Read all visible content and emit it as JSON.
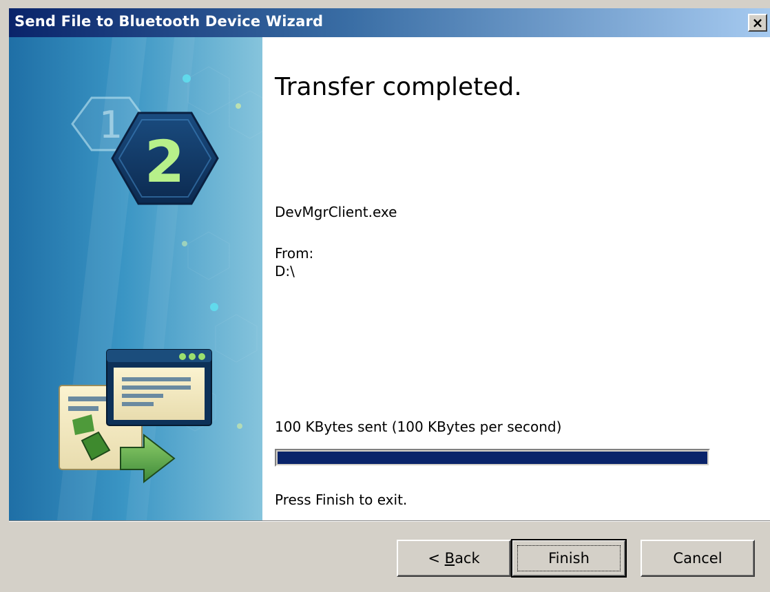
{
  "window": {
    "title": "Send File to Bluetooth Device Wizard",
    "close_label": "×"
  },
  "side_image": {
    "step_inactive": "1",
    "step_active": "2",
    "icon_name": "file-transfer-illustration"
  },
  "content": {
    "heading": "Transfer completed.",
    "file_name": "DevMgrClient.exe",
    "from_label": "From:",
    "from_path": "D:\\",
    "status": "100 KBytes sent (100 KBytes per second)",
    "progress_fraction": 1.0,
    "instruction": "Press Finish to exit."
  },
  "buttons": {
    "back_prefix": "< ",
    "back_accel": "B",
    "back_rest": "ack",
    "finish": "Finish",
    "cancel": "Cancel"
  },
  "colors": {
    "titlebar_start": "#0a246a",
    "titlebar_end": "#a6caf0",
    "progress": "#0a246a",
    "dialog_bg": "#d4d0c8"
  }
}
